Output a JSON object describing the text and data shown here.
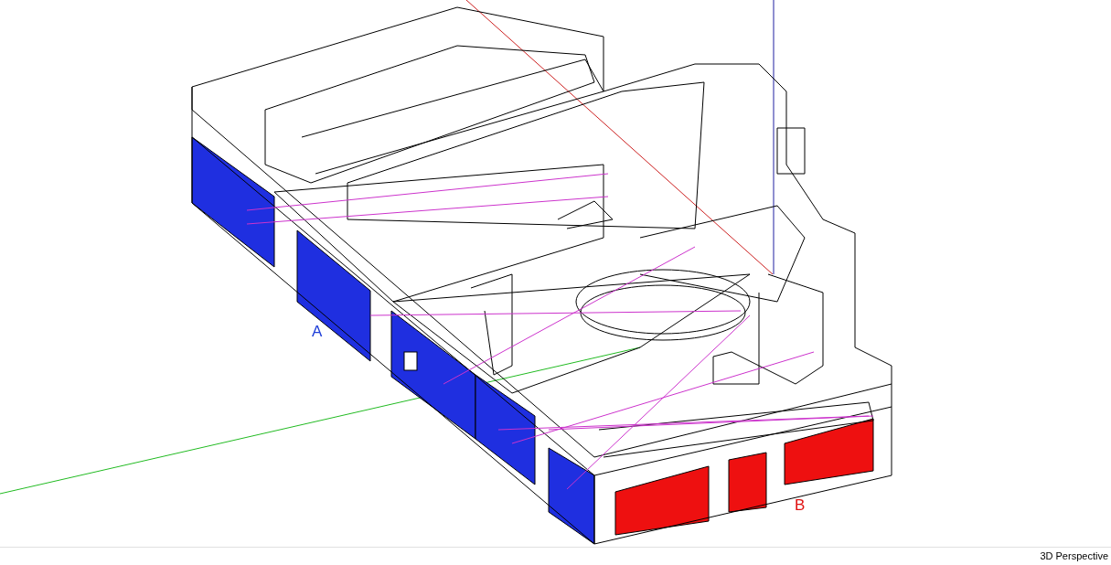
{
  "viewport": {
    "labels": [
      {
        "text": "A",
        "color": "#1f3fd8"
      },
      {
        "text": "B",
        "color": "#e01010"
      }
    ],
    "view_name": "3D Perspective"
  }
}
